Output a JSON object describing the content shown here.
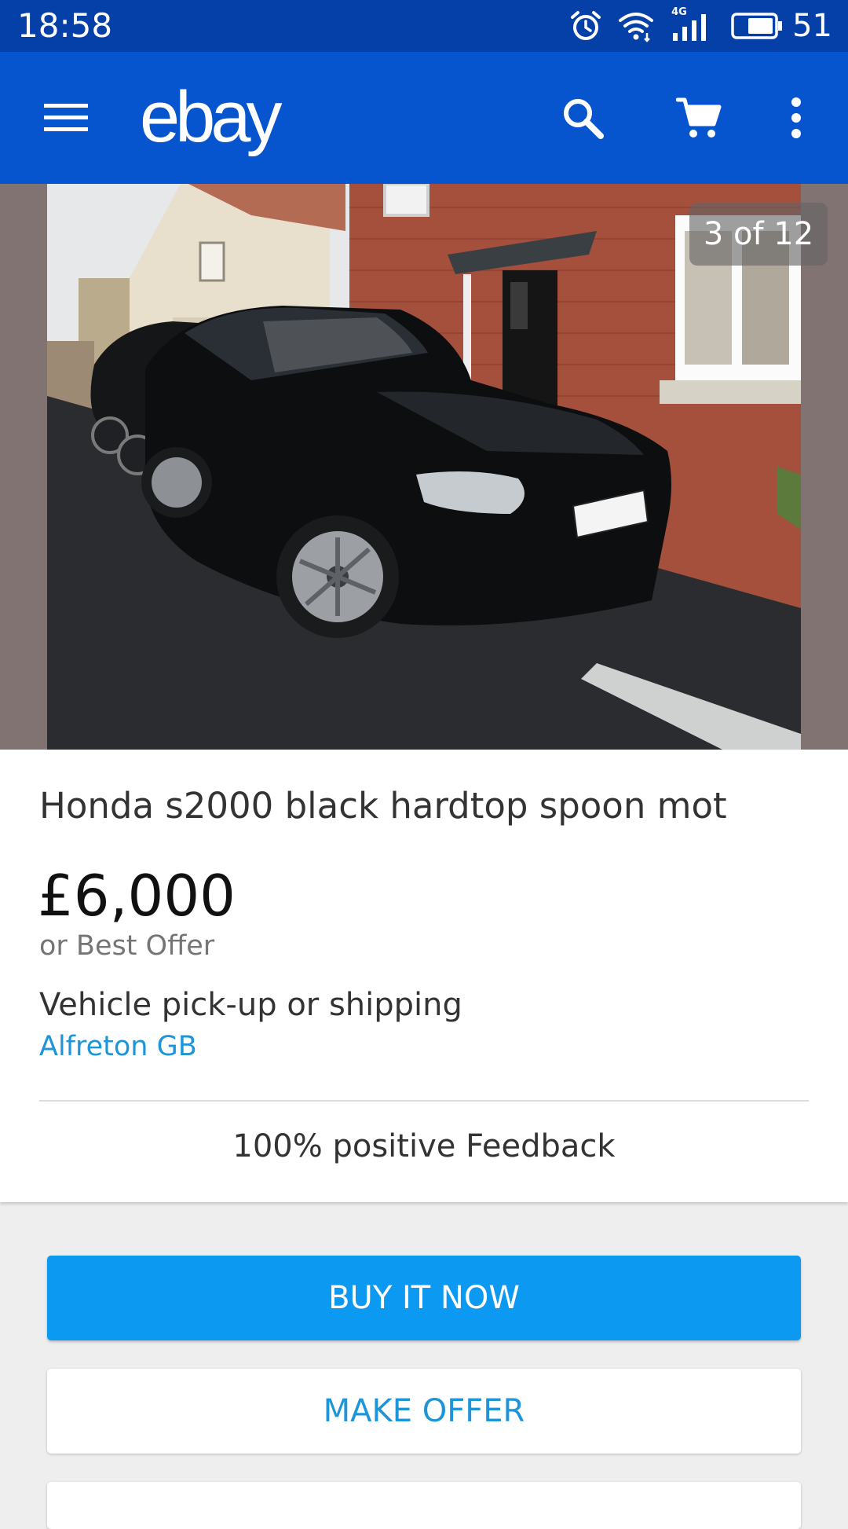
{
  "status_bar": {
    "time": "18:58",
    "network": "4G",
    "battery_level": "51",
    "icons": [
      "alarm-icon",
      "wifi-icon",
      "signal-icon",
      "battery-icon"
    ]
  },
  "header": {
    "brand": "ebay",
    "icons": [
      "menu-icon",
      "search-icon",
      "cart-icon",
      "more-vert-icon"
    ],
    "color": "#0654ce"
  },
  "gallery": {
    "counter": "3 of 12",
    "current_index": 3,
    "total": 12
  },
  "listing": {
    "title": "Honda s2000 black hardtop spoon mot",
    "price": "£6,000",
    "price_note": "or Best Offer",
    "delivery": "Vehicle pick-up or shipping",
    "location": "Alfreton GB",
    "feedback": "100% positive Feedback"
  },
  "actions": {
    "buy_now": "BUY IT NOW",
    "make_offer": "MAKE OFFER"
  },
  "colors": {
    "status_bar": "#0540a9",
    "primary": "#0654ce",
    "buy_button": "#0c99f2",
    "link": "#1e95d8"
  }
}
